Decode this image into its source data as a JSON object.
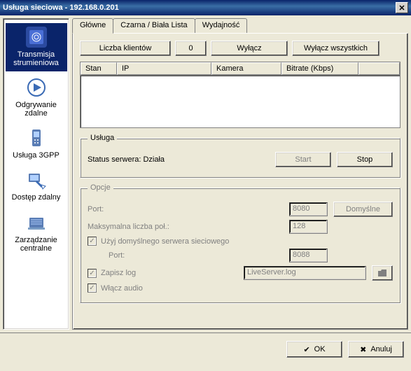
{
  "title": "Usługa sieciowa - 192.168.0.201",
  "sidebar": {
    "items": [
      {
        "label": "Transmisja strumieniowa"
      },
      {
        "label": "Odgrywanie zdalne"
      },
      {
        "label": "Usługa 3GPP"
      },
      {
        "label": "Dostęp zdalny"
      },
      {
        "label": "Zarządzanie centralne"
      }
    ]
  },
  "tabs": [
    {
      "label": "Główne"
    },
    {
      "label": "Czarna / Biała Lista"
    },
    {
      "label": "Wydajność"
    }
  ],
  "clients": {
    "count_label": "Liczba klientów",
    "count": "0",
    "disconnect_label": "Wyłącz",
    "disconnect_all_label": "Wyłącz wszystkich"
  },
  "table": {
    "headers": [
      "Stan",
      "IP",
      "Kamera",
      "Bitrate (Kbps)"
    ]
  },
  "service": {
    "legend": "Usługa",
    "status_label": "Status serwera: Działa",
    "start_label": "Start",
    "stop_label": "Stop"
  },
  "options": {
    "legend": "Opcje",
    "port_label": "Port:",
    "port_value": "8080",
    "default_label": "Domyślne",
    "max_conn_label": "Maksymalna liczba poł.:",
    "max_conn_value": "128",
    "use_default_web": "Użyj domyślnego serwera sieciowego",
    "web_port_label": "Port:",
    "web_port_value": "8088",
    "save_log_label": "Zapisz log",
    "log_file": "LiveServer.log",
    "enable_audio_label": "Włącz audio"
  },
  "footer": {
    "ok": "OK",
    "cancel": "Anuluj"
  }
}
